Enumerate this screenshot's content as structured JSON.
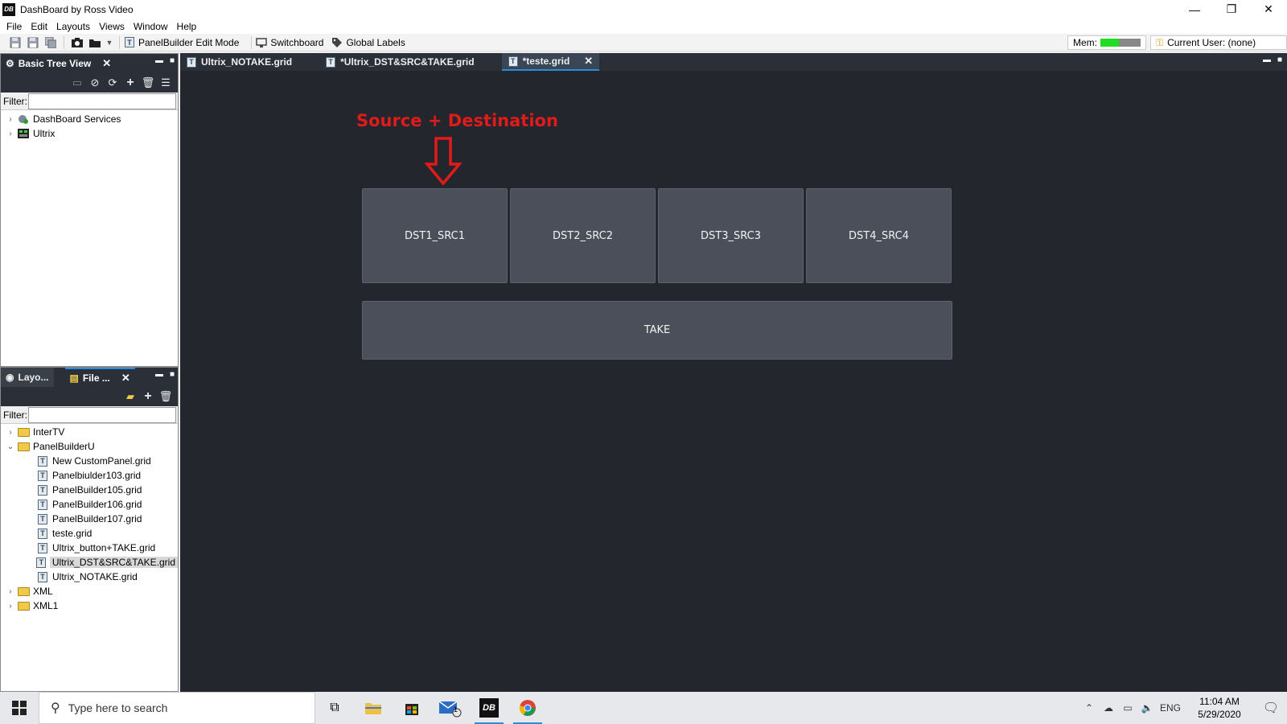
{
  "window": {
    "title": "DashBoard by Ross Video",
    "app_icon_text": "DB",
    "minimize": "—",
    "restore": "❐",
    "close": "✕"
  },
  "menu": [
    "File",
    "Edit",
    "Layouts",
    "Views",
    "Window",
    "Help"
  ],
  "toolbar": {
    "panelbuilder_label": "PanelBuilder Edit Mode",
    "switchboard_label": "Switchboard",
    "global_labels_label": "Global Labels",
    "mem_label": "Mem:",
    "mem_usage_fraction": 0.45,
    "current_user_label": "Current User: (none)"
  },
  "tree_panel": {
    "tab_label": "Basic Tree View",
    "filter_label": "Filter:",
    "filter_value": "",
    "items": [
      {
        "label": "DashBoard Services"
      },
      {
        "label": "Ultrix"
      }
    ]
  },
  "file_panel": {
    "tab1_label": "Layo...",
    "tab2_label": "File ...",
    "filter_label": "Filter:",
    "filter_value": "",
    "items": [
      {
        "label": "InterTV",
        "type": "folder",
        "expanded": false,
        "depth": 0
      },
      {
        "label": "PanelBuilderU",
        "type": "folder",
        "expanded": true,
        "depth": 0
      },
      {
        "label": "New CustomPanel.grid",
        "type": "grid",
        "depth": 1
      },
      {
        "label": "Panelbiulder103.grid",
        "type": "grid",
        "depth": 1
      },
      {
        "label": "PanelBuilder105.grid",
        "type": "grid",
        "depth": 1
      },
      {
        "label": "PanelBuilder106.grid",
        "type": "grid",
        "depth": 1
      },
      {
        "label": "PanelBuilder107.grid",
        "type": "grid",
        "depth": 1
      },
      {
        "label": "teste.grid",
        "type": "grid",
        "depth": 1
      },
      {
        "label": "Ultrix_button+TAKE.grid",
        "type": "grid",
        "depth": 1
      },
      {
        "label": "Ultrix_DST&SRC&TAKE.grid",
        "type": "grid",
        "depth": 1,
        "selected": true
      },
      {
        "label": "Ultrix_NOTAKE.grid",
        "type": "grid",
        "depth": 1
      },
      {
        "label": "XML",
        "type": "folder",
        "expanded": false,
        "depth": 0
      },
      {
        "label": "XML1",
        "type": "folder",
        "expanded": false,
        "depth": 0
      }
    ]
  },
  "editor": {
    "tabs": [
      {
        "label": "Ultrix_NOTAKE.grid",
        "active": false
      },
      {
        "label": "*Ultrix_DST&SRC&TAKE.grid",
        "active": false
      },
      {
        "label": "*teste.grid",
        "active": true
      }
    ],
    "annotation": "Source + Destination",
    "annotation_color": "#e11a1a",
    "buttons": [
      "DST1_SRC1",
      "DST2_SRC2",
      "DST3_SRC3",
      "DST4_SRC4"
    ],
    "take_label": "TAKE"
  },
  "taskbar": {
    "search_placeholder": "Type here to search",
    "mail_badge": "1",
    "language": "ENG",
    "time": "11:04 AM",
    "date": "5/29/2020"
  }
}
